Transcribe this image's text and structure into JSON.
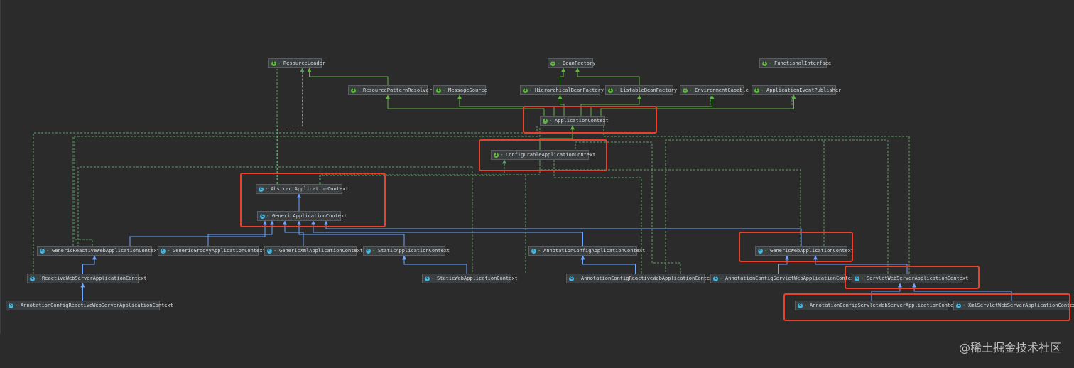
{
  "diagram": {
    "nodes": [
      {
        "id": "resource-loader",
        "label": "ResourceLoader",
        "kind": "interface"
      },
      {
        "id": "bean-factory",
        "label": "BeanFactory",
        "kind": "interface"
      },
      {
        "id": "functional-interface",
        "label": "FunctionalInterface",
        "kind": "interface"
      },
      {
        "id": "resource-pattern-resolver",
        "label": "ResourcePatternResolver",
        "kind": "interface"
      },
      {
        "id": "message-source",
        "label": "MessageSource",
        "kind": "interface"
      },
      {
        "id": "hierarchical-bean-factory",
        "label": "HierarchicalBeanFactory",
        "kind": "interface"
      },
      {
        "id": "listable-bean-factory",
        "label": "ListableBeanFactory",
        "kind": "interface"
      },
      {
        "id": "environment-capable",
        "label": "EnvironmentCapable",
        "kind": "interface"
      },
      {
        "id": "application-event-publisher",
        "label": "ApplicationEventPublisher",
        "kind": "interface"
      },
      {
        "id": "application-context",
        "label": "ApplicationContext",
        "kind": "interface"
      },
      {
        "id": "configurable-application-context",
        "label": "ConfigurableApplicationContext",
        "kind": "interface"
      },
      {
        "id": "abstract-application-context",
        "label": "AbstractApplicationContext",
        "kind": "class"
      },
      {
        "id": "generic-application-context",
        "label": "GenericApplicationContext",
        "kind": "class"
      },
      {
        "id": "generic-reactive-web-application-context",
        "label": "GenericReactiveWebApplicationContext",
        "kind": "class"
      },
      {
        "id": "generic-groovy-application-context",
        "label": "GenericGroovyApplicationContext",
        "kind": "class"
      },
      {
        "id": "generic-xml-application-context",
        "label": "GenericXmlApplicationContext",
        "kind": "class"
      },
      {
        "id": "static-application-context",
        "label": "StaticApplicationContext",
        "kind": "class"
      },
      {
        "id": "annotation-config-application-context",
        "label": "AnnotationConfigApplicationContext",
        "kind": "class"
      },
      {
        "id": "generic-web-application-context",
        "label": "GenericWebApplicationContext",
        "kind": "class"
      },
      {
        "id": "reactive-web-server-application-context",
        "label": "ReactiveWebServerApplicationContext",
        "kind": "class"
      },
      {
        "id": "static-web-application-context",
        "label": "StaticWebApplicationContext",
        "kind": "class"
      },
      {
        "id": "annotation-config-reactive-web-application-context",
        "label": "AnnotationConfigReactiveWebApplicationContext",
        "kind": "class"
      },
      {
        "id": "annotation-config-servlet-web-application-context",
        "label": "AnnotationConfigServletWebApplicationContext",
        "kind": "class"
      },
      {
        "id": "servlet-web-server-application-context",
        "label": "ServletWebServerApplicationContext",
        "kind": "class"
      },
      {
        "id": "annotation-config-reactive-web-server-application-context",
        "label": "AnnotationConfigReactiveWebServerApplicationContext",
        "kind": "class"
      },
      {
        "id": "annotation-config-servlet-web-server-application-context",
        "label": "AnnotationConfigServletWebServerApplicationContext",
        "kind": "class"
      },
      {
        "id": "xml-servlet-web-server-application-context",
        "label": "XmlServletWebServerApplicationContext",
        "kind": "class"
      }
    ],
    "edges": [
      {
        "from": "resource-pattern-resolver",
        "to": "resource-loader",
        "type": "extends"
      },
      {
        "from": "hierarchical-bean-factory",
        "to": "bean-factory",
        "type": "extends"
      },
      {
        "from": "listable-bean-factory",
        "to": "bean-factory",
        "type": "extends"
      },
      {
        "from": "application-context",
        "to": "resource-pattern-resolver",
        "type": "extends"
      },
      {
        "from": "application-context",
        "to": "message-source",
        "type": "extends"
      },
      {
        "from": "application-context",
        "to": "hierarchical-bean-factory",
        "type": "extends"
      },
      {
        "from": "application-context",
        "to": "listable-bean-factory",
        "type": "extends"
      },
      {
        "from": "application-context",
        "to": "environment-capable",
        "type": "extends"
      },
      {
        "from": "application-context",
        "to": "application-event-publisher",
        "type": "extends"
      },
      {
        "from": "configurable-application-context",
        "to": "application-context",
        "type": "extends"
      },
      {
        "from": "abstract-application-context",
        "to": "configurable-application-context",
        "type": "implements"
      },
      {
        "from": "abstract-application-context",
        "to": "resource-loader",
        "type": "implements"
      },
      {
        "from": "generic-application-context",
        "to": "abstract-application-context",
        "type": "extends"
      },
      {
        "from": "generic-reactive-web-application-context",
        "to": "generic-application-context",
        "type": "extends"
      },
      {
        "from": "generic-groovy-application-context",
        "to": "generic-application-context",
        "type": "extends"
      },
      {
        "from": "generic-xml-application-context",
        "to": "generic-application-context",
        "type": "extends"
      },
      {
        "from": "static-application-context",
        "to": "generic-application-context",
        "type": "extends"
      },
      {
        "from": "annotation-config-application-context",
        "to": "generic-application-context",
        "type": "extends"
      },
      {
        "from": "generic-web-application-context",
        "to": "generic-application-context",
        "type": "extends"
      },
      {
        "from": "reactive-web-server-application-context",
        "to": "generic-reactive-web-application-context",
        "type": "extends"
      },
      {
        "from": "annotation-config-reactive-web-server-application-context",
        "to": "reactive-web-server-application-context",
        "type": "extends"
      },
      {
        "from": "static-web-application-context",
        "to": "static-application-context",
        "type": "extends"
      },
      {
        "from": "annotation-config-reactive-web-application-context",
        "to": "annotation-config-application-context",
        "type": "extends"
      },
      {
        "from": "annotation-config-servlet-web-application-context",
        "to": "generic-web-application-context",
        "type": "extends"
      },
      {
        "from": "servlet-web-server-application-context",
        "to": "generic-web-application-context",
        "type": "extends"
      },
      {
        "from": "annotation-config-servlet-web-server-application-context",
        "to": "servlet-web-server-application-context",
        "type": "extends"
      },
      {
        "from": "xml-servlet-web-server-application-context",
        "to": "servlet-web-server-application-context",
        "type": "extends"
      }
    ],
    "highlighted": [
      "application-context",
      "configurable-application-context",
      "abstract-application-context",
      "generic-application-context",
      "generic-web-application-context",
      "servlet-web-server-application-context",
      "annotation-config-servlet-web-server-application-context",
      "xml-servlet-web-server-application-context"
    ],
    "colors": {
      "background": "#2b2b2b",
      "node_fill": "#3c3f41",
      "interface_icon": "#62b543",
      "class_icon": "#40b6e0",
      "extends_interface_line": "#62b543",
      "extends_class_line": "#6ea7ff",
      "implements_line": "#5f9e6a",
      "highlight": "#e8412c"
    }
  },
  "watermark": "@稀土掘金技术社区"
}
